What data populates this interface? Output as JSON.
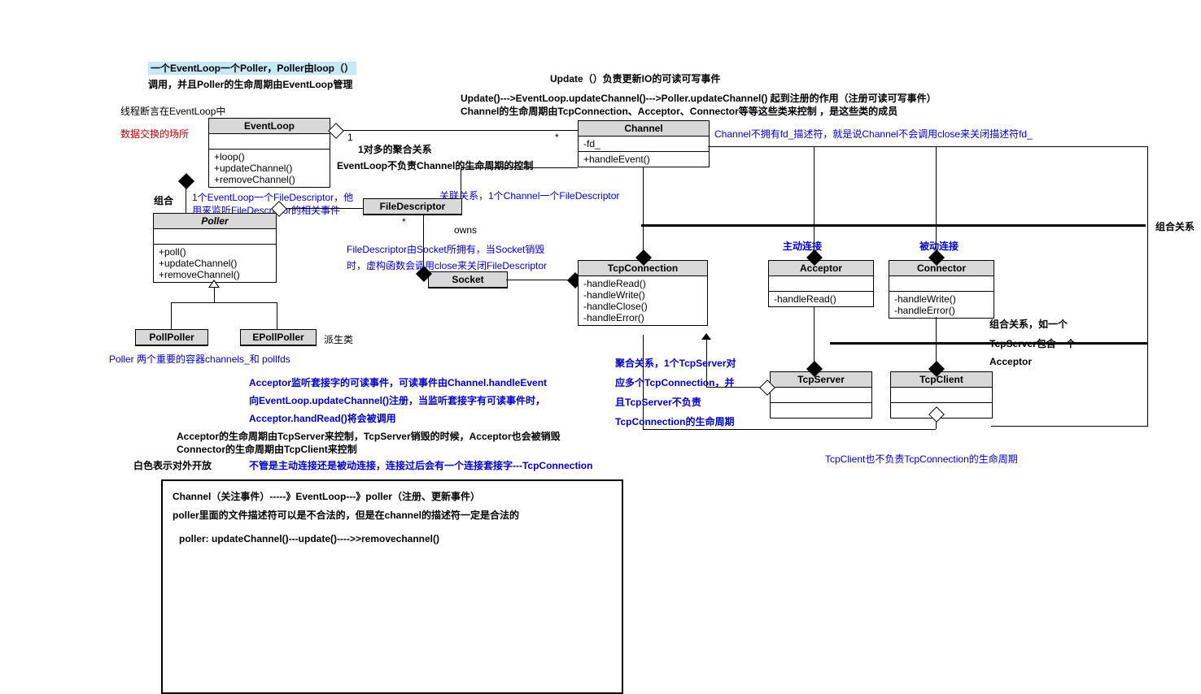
{
  "ann": {
    "top1": "一个EventLoop一个Poller，Poller由loop（）",
    "top2": "调用，并且Poller的生命周期由EventLoop管理",
    "top3": "Update（）负责更新IO的可读可写事件",
    "top4": "Update()--->EventLoop.updateChannel()--->Poller.updateChannel() 起到注册的作用（注册可读可写事件）",
    "top5": "Channel的生命周期由TcpConnection、Acceptor、Connector等等这些类来控制 ，是这些类的成员",
    "thread_assert": "线程断言在EventLoop中",
    "data_exchange": "数据交换的场所",
    "aggregation1": "1对多的聚合关系",
    "aggregation2": "EventLoop不负责Channel的生命周期的控制",
    "mult1": "1",
    "mult2": "*",
    "mult3": "*",
    "channel_fd": "Channel不拥有fd_描述符，就是说Channel不会调用close来关闭描述符fd_",
    "combo": "组合",
    "fd_line1": "1个EventLoop一个FileDescriptor，他",
    "fd_line2": "用来监听FileDescriptor的相关事件",
    "assoc": "关联关系，1个Channel一个FileDescriptor",
    "owns": "owns",
    "socket1": "FileDescriptor由Socket所拥有，当Socket销毁",
    "socket2": "时，虚构函数会调用close来关闭FileDescriptor",
    "derived": "派生类",
    "poller_note": "Poller 两个重要的容器channels_和 pollfds",
    "acc1": "Acceptor监听套接字的可读事件，可读事件由Channel.handleEvent",
    "acc2": "向EventLoop.updateChannel()注册，当监听套接字有可读事件时，",
    "acc3": "Acceptor.handRead()将会被调用",
    "lifecycle1": "Acceptor的生命周期由TcpServer来控制，TcpServer销毁的时候，Acceptor也会被销毁",
    "lifecycle2": "Connector的生命周期由TcpClient来控制",
    "white": "白色表示对外开放",
    "conn_either": "不管是主动连接还是被动连接，连接过后会有一个连接套接字---TcpConnection",
    "combo_rel": "组合关系",
    "active": "主动连接",
    "passive": "被动连接",
    "combo_rel2a": "组合关系，如一个",
    "combo_rel2b": "TcpServer包含一个",
    "combo_rel2c": "Acceptor",
    "agg1": "聚合关系，1个TcpServer对",
    "agg2": "应多个TcpConnection，并",
    "agg3": "且TcpServer不负责",
    "agg4": "TcpConnection的生命周期",
    "tcpclient_note": "TcpClient也不负责TcpConnection的生命周期",
    "note1": "Channel（关注事件）-----》EventLoop---》poller（注册、更新事件）",
    "note2": "poller里面的文件描述符可以是不合法的，但是在channel的描述符一定是合法的",
    "note3": "poller: updateChannel()---update()---->>removechannel()"
  },
  "uml": {
    "eventloop": {
      "title": "EventLoop",
      "m": "+loop()\n+updateChannel()\n+removeChannel()"
    },
    "poller": {
      "title": "Poller",
      "m": "+poll()\n+updateChannel()\n+removeChannel()"
    },
    "pollpoller": {
      "title": "PollPoller"
    },
    "epollpoller": {
      "title": "EPollPoller"
    },
    "filedescriptor": {
      "title": "FileDescriptor"
    },
    "socket": {
      "title": "Socket"
    },
    "channel": {
      "title": "Channel",
      "a": "-fd_",
      "m": "+handleEvent()"
    },
    "tcpconnection": {
      "title": "TcpConnection",
      "m": "-handleRead()\n-handleWrite()\n-handleClose()\n-handleError()"
    },
    "acceptor": {
      "title": "Acceptor",
      "m": "-handleRead()"
    },
    "connector": {
      "title": "Connector",
      "m": "-handleWrite()\n-handleError()"
    },
    "tcpserver": {
      "title": "TcpServer"
    },
    "tcpclient": {
      "title": "TcpClient"
    }
  }
}
